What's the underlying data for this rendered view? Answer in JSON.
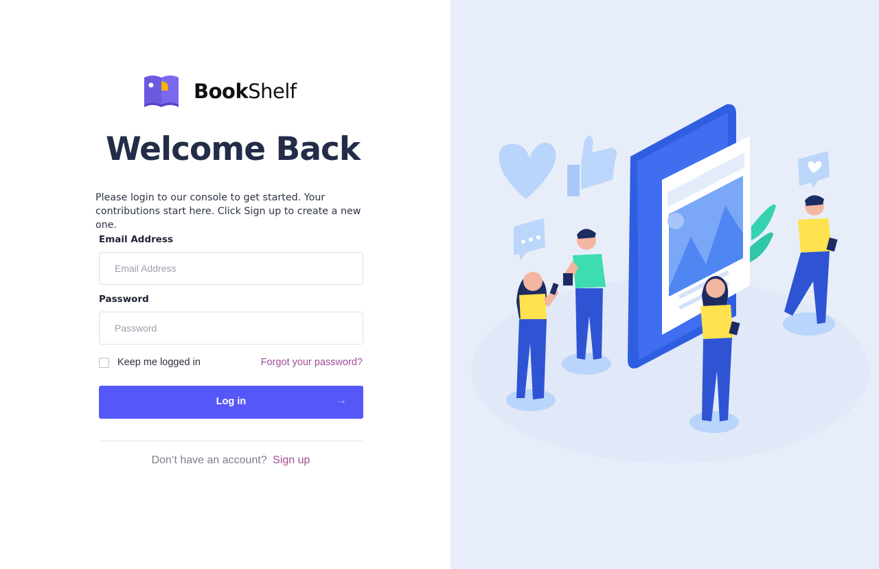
{
  "brand": {
    "name_bold": "Book",
    "name_rest": "Shelf"
  },
  "heading": "Welcome Back",
  "intro": "Please login to our console to get started. Your contributions start here. Click Sign up to create a new one.",
  "form": {
    "email_label": "Email Address",
    "email_placeholder": "Email Address",
    "email_value": "",
    "password_label": "Password",
    "password_placeholder": "Password",
    "password_value": "",
    "keep_logged_in_label": "Keep me logged in",
    "keep_logged_in_checked": false,
    "forgot_password": "Forgot your password?",
    "login_label": "Log in",
    "login_arrow": "→"
  },
  "signup": {
    "question": "Don’t have an account?",
    "link": "Sign up"
  },
  "colors": {
    "accent": "#5557f8",
    "link": "#a14b9a",
    "heading": "#232d48",
    "illustration_bg": "#e8eef9"
  }
}
